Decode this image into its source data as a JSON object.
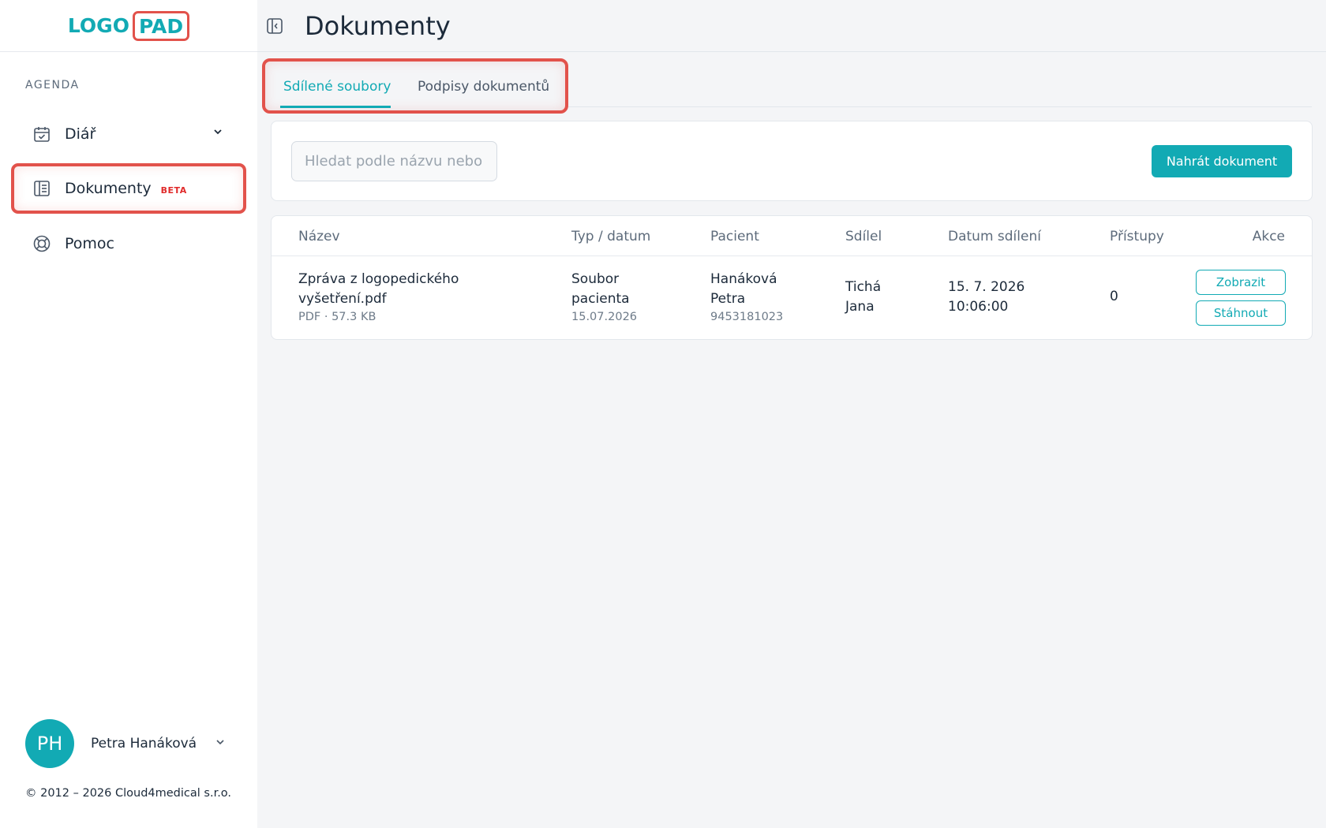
{
  "logo": {
    "part1": "LOGO",
    "part2": "PAD"
  },
  "sidebar": {
    "section_label": "AGENDA",
    "items": [
      {
        "label": "Diář",
        "icon": "calendar-check-icon",
        "has_chevron": true
      },
      {
        "label": "Dokumenty",
        "icon": "document-list-icon",
        "badge": "BETA",
        "active": true
      },
      {
        "label": "Pomoc",
        "icon": "lifebuoy-icon"
      }
    ],
    "user": {
      "initials": "PH",
      "name": "Petra Hanáková"
    },
    "copyright": "© 2012 – 2026 Cloud4medical s.r.o."
  },
  "header": {
    "title": "Dokumenty"
  },
  "tabs": [
    {
      "label": "Sdílené soubory",
      "active": true
    },
    {
      "label": "Podpisy dokumentů",
      "active": false
    }
  ],
  "search": {
    "placeholder": "Hledat podle názvu nebo pacienta",
    "value": ""
  },
  "toolbar": {
    "upload_label": "Nahrát dokument"
  },
  "table": {
    "columns": [
      "Název",
      "Typ / datum",
      "Pacient",
      "Sdílel",
      "Datum sdílení",
      "Přístupy",
      "Akce"
    ],
    "rows": [
      {
        "name_line1": "Zpráva z logopedického",
        "name_line2": "vyšetření.pdf",
        "file_meta": "PDF · 57.3 KB",
        "type_line1": "Soubor",
        "type_line2": "pacienta",
        "type_date": "15.07.2026",
        "patient_line1": "Hanáková",
        "patient_line2": "Petra",
        "patient_id": "9453181023",
        "shared_by_line1": "Tichá",
        "shared_by_line2": "Jana",
        "shared_date": "15. 7. 2026",
        "shared_time": "10:06:00",
        "access_count": "0",
        "action_view": "Zobrazit",
        "action_download": "Stáhnout"
      }
    ]
  },
  "colors": {
    "accent": "#12aab4",
    "highlight": "#e2524b",
    "badge": "#e02a2a",
    "text": "#1c2a3a"
  }
}
